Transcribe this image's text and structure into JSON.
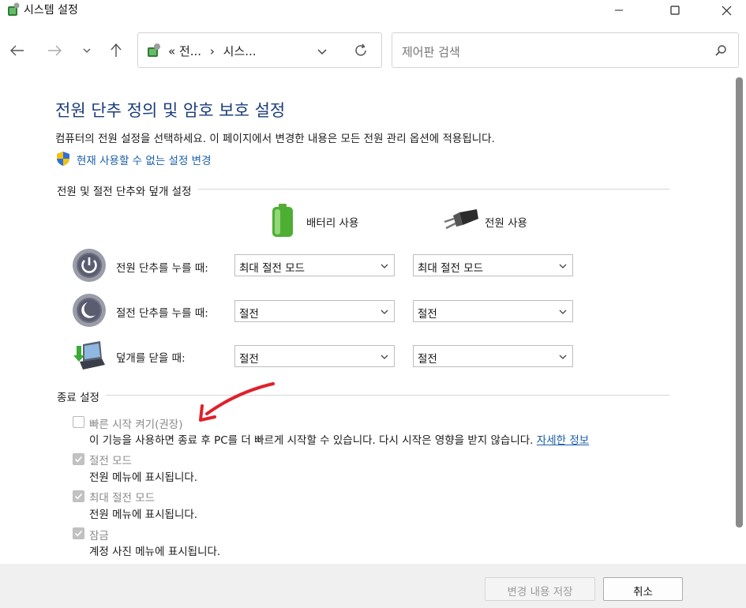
{
  "window": {
    "title": "시스템 설정",
    "controls": {
      "minimize": "minimize-icon",
      "maximize": "maximize-icon",
      "close": "close-icon"
    }
  },
  "nav": {
    "breadcrumb": [
      "«",
      "전...",
      "›",
      "시스..."
    ],
    "search_placeholder": "제어판 검색"
  },
  "page": {
    "heading": "전원 단추 정의 및 암호 보호 설정",
    "description": "컴퓨터의 전원 설정을 선택하세요. 이 페이지에서 변경한 내용은 모든 전원 관리 옵션에 적용됩니다.",
    "change_link": "현재 사용할 수 없는 설정 변경"
  },
  "power_section": {
    "label": "전원 및 절전 단추와 덮개 설정",
    "columns": {
      "battery": "배터리 사용",
      "plugged": "전원 사용"
    },
    "rows": [
      {
        "label": "전원 단추를 누를 때:",
        "icon": "power-button-icon",
        "battery": "최대 절전 모드",
        "plugged": "최대 절전 모드"
      },
      {
        "label": "절전 단추를 누를 때:",
        "icon": "sleep-button-icon",
        "battery": "절전",
        "plugged": "절전"
      },
      {
        "label": "덮개를 닫을 때:",
        "icon": "laptop-lid-icon",
        "battery": "절전",
        "plugged": "절전"
      }
    ]
  },
  "shutdown_section": {
    "label": "종료 설정",
    "options": [
      {
        "label": "빠른 시작 켜기(권장)",
        "checked": false,
        "description": "이 기능을 사용하면 종료 후 PC를 더 빠르게 시작할 수 있습니다. 다시 시작은 영향을 받지 않습니다.",
        "link": "자세한 정보"
      },
      {
        "label": "절전 모드",
        "checked": true,
        "description": "전원 메뉴에 표시됩니다."
      },
      {
        "label": "최대 절전 모드",
        "checked": true,
        "description": "전원 메뉴에 표시됩니다."
      },
      {
        "label": "잠금",
        "checked": true,
        "description": "계정 사진 메뉴에 표시됩니다."
      }
    ]
  },
  "footer": {
    "save_label": "변경 내용 저장",
    "cancel_label": "취소"
  },
  "colors": {
    "heading": "#1b3d7a",
    "link": "#1a5fa8",
    "annotation_arrow": "#e0202a"
  }
}
